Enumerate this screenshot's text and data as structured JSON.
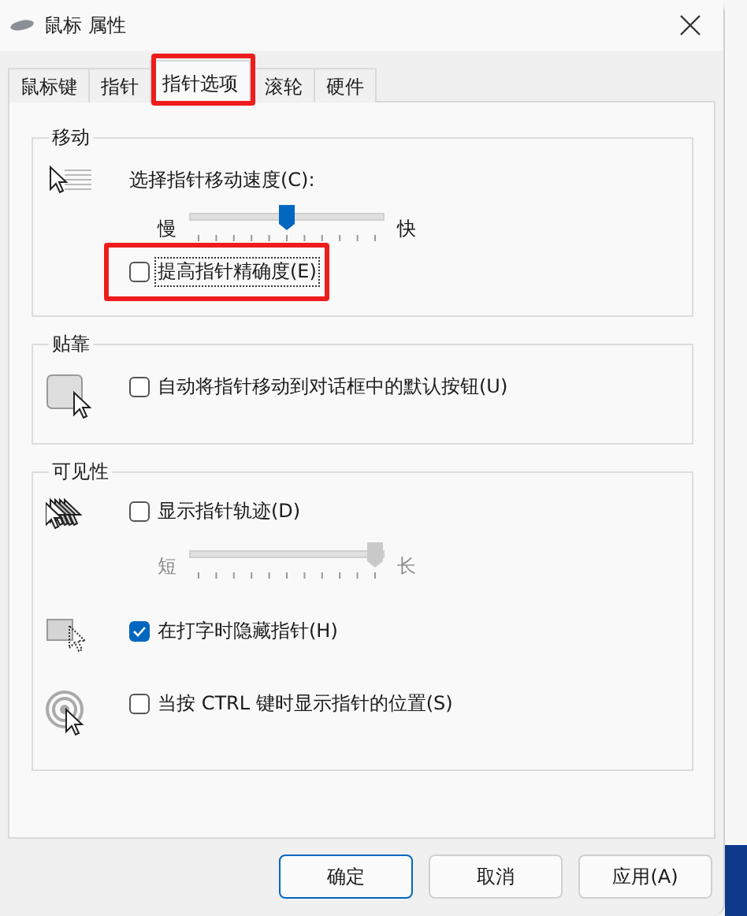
{
  "window": {
    "title": "鼠标 属性"
  },
  "tabs": [
    {
      "label": "鼠标键",
      "selected": false,
      "highlighted": false
    },
    {
      "label": "指针",
      "selected": false,
      "highlighted": false
    },
    {
      "label": "指针选项",
      "selected": true,
      "highlighted": true
    },
    {
      "label": "滚轮",
      "selected": false,
      "highlighted": false
    },
    {
      "label": "硬件",
      "selected": false,
      "highlighted": false
    }
  ],
  "groups": [
    {
      "title": "移动",
      "rows": [
        {
          "kind": "label",
          "text": "选择指针移动速度(C):"
        },
        {
          "kind": "slider",
          "min_label": "慢",
          "max_label": "快",
          "level": 0.5,
          "disabled": false
        },
        {
          "kind": "checkbox",
          "label": "提高指针精确度(E)",
          "checked": false,
          "focused": true,
          "highlighted": true
        }
      ]
    },
    {
      "title": "贴靠",
      "rows": [
        {
          "kind": "checkbox",
          "label": "自动将指针移动到对话框中的默认按钮(U)",
          "checked": false,
          "focused": false,
          "highlighted": false
        }
      ]
    },
    {
      "title": "可见性",
      "rows": [
        {
          "kind": "checkbox",
          "label": "显示指针轨迹(D)",
          "checked": false,
          "focused": false,
          "highlighted": false
        },
        {
          "kind": "slider",
          "min_label": "短",
          "max_label": "长",
          "level": 1.0,
          "disabled": true
        },
        {
          "kind": "checkbox",
          "label": "在打字时隐藏指针(H)",
          "checked": true,
          "focused": false,
          "highlighted": false
        },
        {
          "kind": "checkbox",
          "label": "当按 CTRL 键时显示指针的位置(S)",
          "checked": false,
          "focused": false,
          "highlighted": false
        }
      ]
    }
  ],
  "buttons": [
    {
      "label": "确定",
      "default": true
    },
    {
      "label": "取消",
      "default": false
    },
    {
      "label": "应用(A)",
      "default": false
    }
  ]
}
